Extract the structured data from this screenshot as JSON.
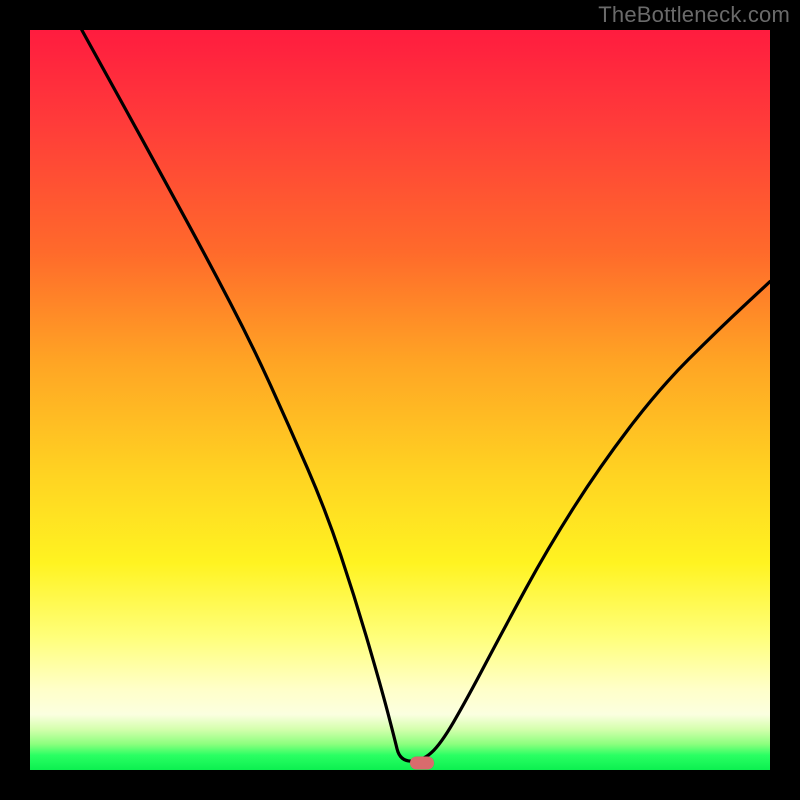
{
  "watermark": "TheBottleneck.com",
  "colors": {
    "frame_bg": "#000000",
    "curve_stroke": "#000000",
    "marker_fill": "#d96b6d",
    "gradient_top": "#ff1c3f",
    "gradient_bottom": "#0cf050"
  },
  "chart_data": {
    "type": "line",
    "title": "",
    "xlabel": "",
    "ylabel": "",
    "xlim": [
      0,
      100
    ],
    "ylim": [
      0,
      100
    ],
    "grid": false,
    "legend": false,
    "notch_x": 51,
    "notch_y": 1,
    "marker": {
      "x": 53,
      "y": 1
    },
    "series": [
      {
        "name": "bottleneck-curve",
        "x": [
          7,
          12,
          18,
          24,
          30,
          35,
          40,
          44,
          47.5,
          49.2,
          50,
          53,
          55.5,
          59,
          64,
          70,
          77,
          85,
          93,
          100
        ],
        "y": [
          100,
          91,
          80,
          69,
          57.5,
          46.5,
          35,
          23,
          11,
          4.5,
          1.2,
          1.2,
          3.5,
          9.5,
          19,
          30,
          41,
          51.5,
          59.5,
          66
        ]
      }
    ]
  }
}
